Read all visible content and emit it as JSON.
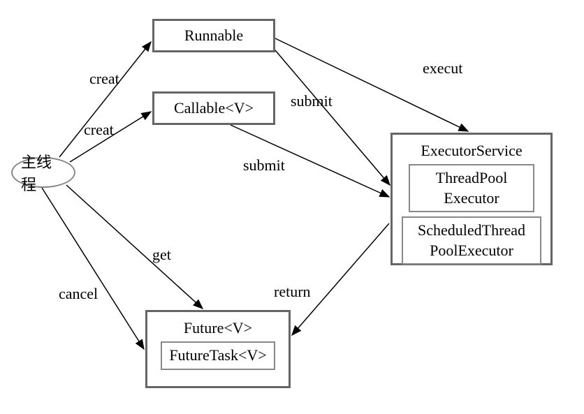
{
  "nodes": {
    "main_thread": "主线程",
    "runnable": "Runnable",
    "callable": "Callable<V>",
    "executor_service": "ExecutorService",
    "threadpool_executor": "ThreadPool\nExecutor",
    "scheduled_threadpool": "ScheduledThread\nPoolExecutor",
    "future": "Future<V>",
    "future_task": "FutureTask<V>"
  },
  "edges": {
    "creat1": "creat",
    "creat2": "creat",
    "execut": "execut",
    "submit1": "submit",
    "submit2": "submit",
    "get": "get",
    "cancel": "cancel",
    "return": "return"
  }
}
